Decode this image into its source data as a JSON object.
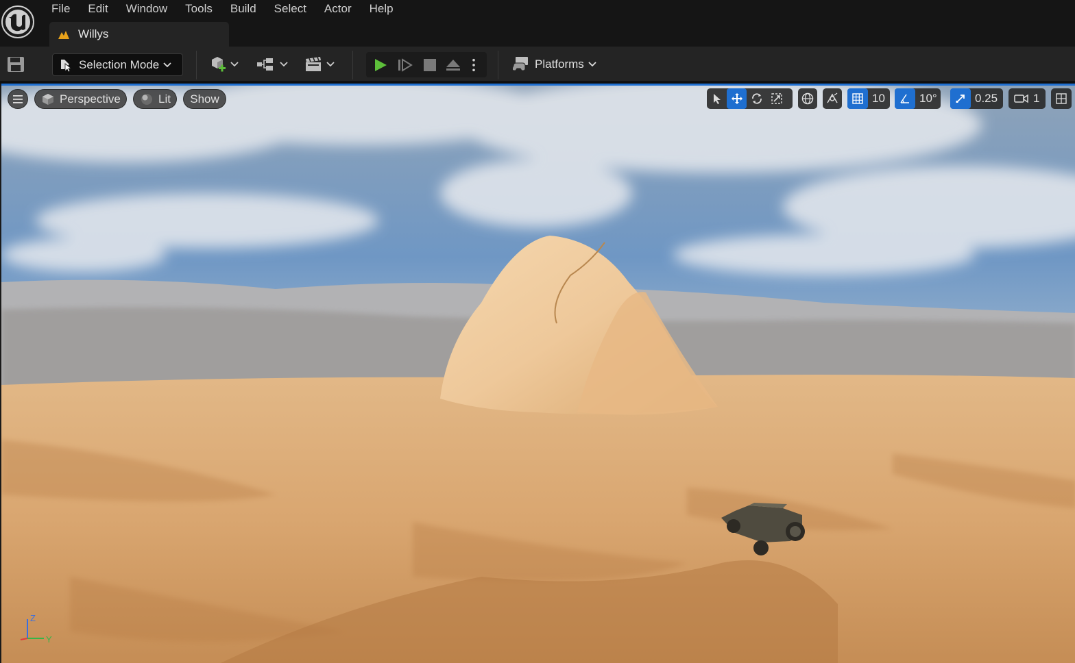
{
  "menu": {
    "items": [
      "File",
      "Edit",
      "Window",
      "Tools",
      "Build",
      "Select",
      "Actor",
      "Help"
    ]
  },
  "document_tab": {
    "label": "Willys",
    "icon": "level-icon"
  },
  "toolbar": {
    "selection_mode_label": "Selection Mode",
    "platforms_label": "Platforms",
    "play_color": "#5dbf3a"
  },
  "viewport": {
    "view_mode_label": "Perspective",
    "lighting_label": "Lit",
    "show_label": "Show",
    "grid_snap_value": "10",
    "rotation_snap_value": "10°",
    "scale_snap_value": "0.25",
    "camera_speed_value": "1",
    "accent_color": "#1f6fd0"
  },
  "axis_gizmo": {
    "x_label": "",
    "y_label": "Y",
    "z_label": "Z"
  }
}
